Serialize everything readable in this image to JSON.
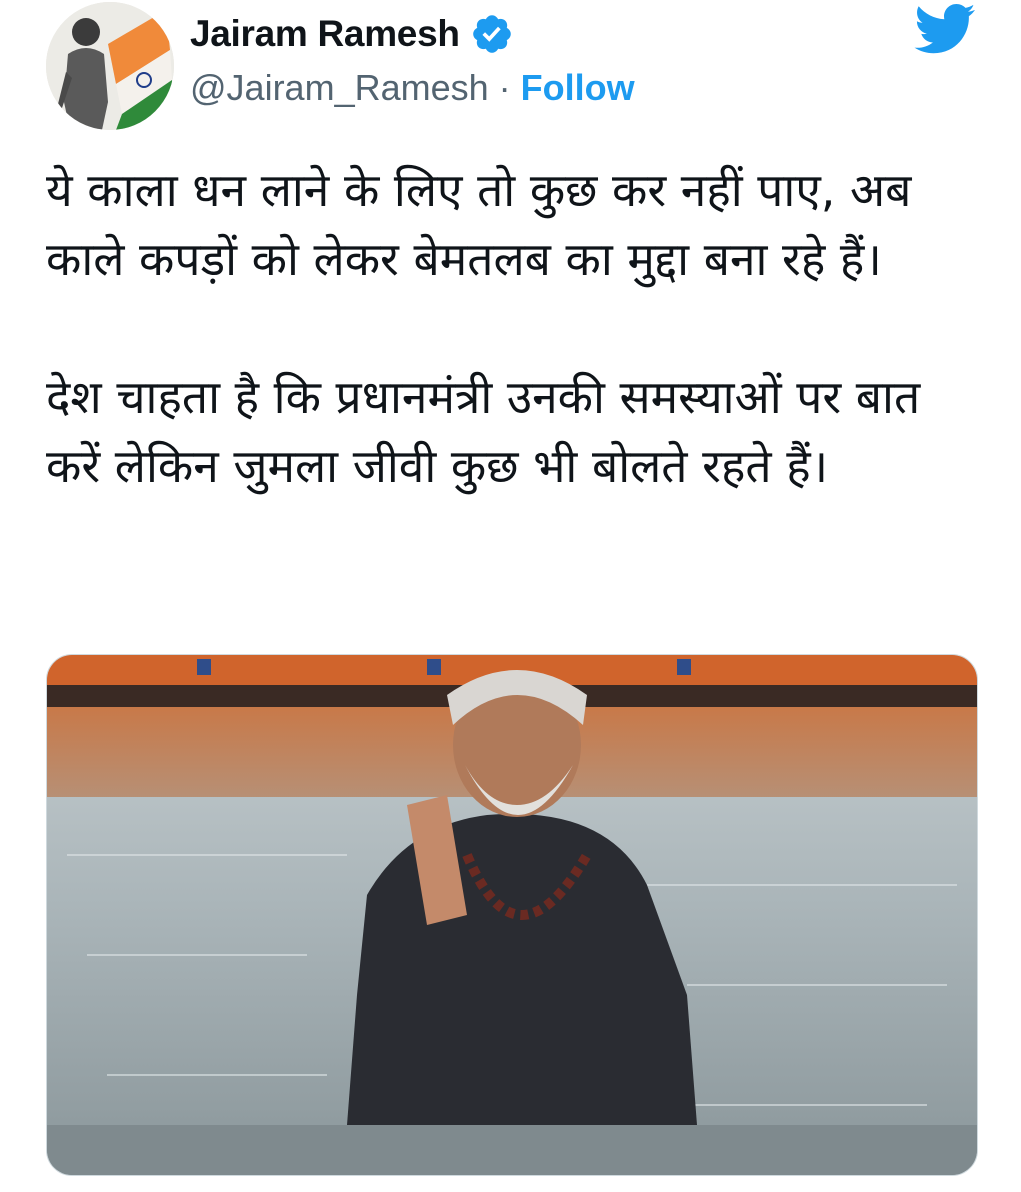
{
  "author": {
    "name": "Jairam Ramesh",
    "handle": "@Jairam_Ramesh",
    "separator": "·",
    "follow_label": "Follow",
    "verified_icon": "verified-badge-icon",
    "avatar_icon": "profile-avatar-image"
  },
  "brand": {
    "logo_icon": "twitter-bird-icon",
    "accent_color": "#1d9bf0"
  },
  "tweet": {
    "paragraphs": [
      "ये काला धन लाने के लिए तो कुछ कर नहीं पाए, अब काले कपड़ों को लेकर बेमतलब का मुद्दा बना रहे हैं।",
      "देश चाहता है कि प्रधानमंत्री उनकी समस्याओं पर बात करें लेकिन जुमला जीवी कुछ भी बोलते रहते हैं।"
    ]
  },
  "media": {
    "kind": "photo"
  }
}
